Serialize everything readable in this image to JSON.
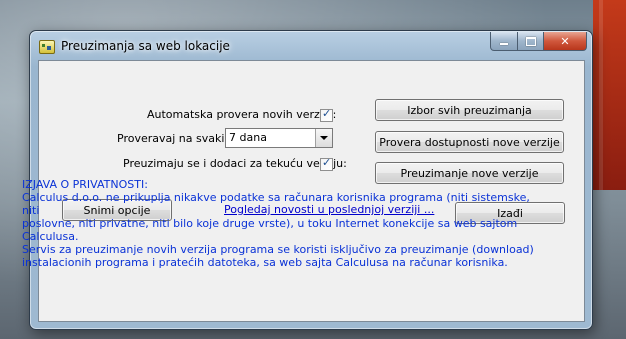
{
  "window": {
    "title": "Preuzimanja sa web lokacije"
  },
  "options": {
    "auto_check_label": "Automatska provera novih verzija:",
    "auto_check": true,
    "interval_label": "Proveravaj na svakih:",
    "interval_value": "7 dana",
    "addons_label": "Preuzimaju se i dodaci za tekuću verziju:",
    "addons": true
  },
  "buttons": {
    "all_downloads": "Izbor svih preuzimanja",
    "check_new": "Provera dostupnosti nove verzije",
    "download_new": "Preuzimanje nove verzije",
    "save_options": "Snimi opcije",
    "exit": "Izađi"
  },
  "link": {
    "news": "Pogledaj novosti u poslednjoj verziji ..."
  },
  "privacy": {
    "heading": "IZJAVA O PRIVATNOSTI:",
    "lines": [
      "Calculus d.o.o. ne prikuplja nikakve podatke sa računara korisnika programa (niti sistemske, niti",
      "poslovne, niti privatne, niti bilo koje druge vrste),  u toku Internet konekcije sa web sajtom Calculusa.",
      "Servis za preuzimanje novih verzija programa se koristi isključivo za preuzimanje (download)",
      "instalacionih programa i pratećih datoteka, sa web sajta Calculusa na računar korisnika."
    ]
  },
  "icons": {
    "app": "calculus-app-icon",
    "close": "close-icon",
    "minimize": "minimize-icon",
    "maximize": "maximize-icon",
    "dropdown": "chevron-down-icon",
    "check": "checkmark-icon"
  },
  "colors": {
    "link": "#0000cc",
    "privacy_text": "#0a32d6",
    "close_button": "#c84a2e"
  }
}
